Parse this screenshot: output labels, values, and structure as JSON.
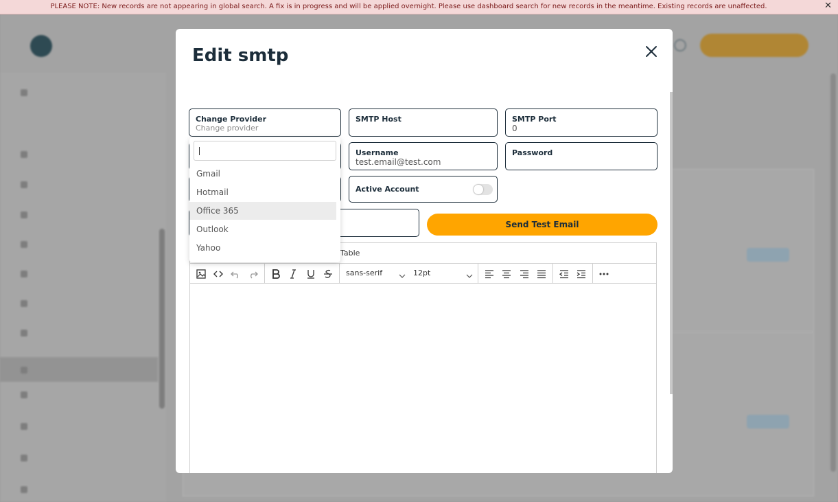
{
  "banner": {
    "text": "PLEASE NOTE: New records are not appearing in global search. A fix is in progress and will be applied overnight. Please use dashboard search for new records in the meantime. Existing records are unaffected.",
    "close": "✕"
  },
  "modal": {
    "title": "Edit smtp",
    "fields": {
      "change_provider": {
        "label": "Change Provider",
        "placeholder": "Change provider"
      },
      "smtp_host": {
        "label": "SMTP Host",
        "value": ""
      },
      "smtp_port": {
        "label": "SMTP Port",
        "value": "0"
      },
      "username": {
        "label": "Username",
        "value": "test.email@test.com"
      },
      "password": {
        "label": "Password",
        "value": ""
      },
      "active_account": {
        "label": "Active Account",
        "checked": false
      }
    },
    "send_test_label": "Send Test Email",
    "editor": {
      "menu": [
        "Table"
      ],
      "font_family": "sans-serif",
      "font_size": "12pt"
    }
  },
  "dropdown": {
    "search_value": "",
    "options": [
      "Gmail",
      "Hotmail",
      "Office 365",
      "Outlook",
      "Yahoo"
    ],
    "highlighted": "Office 365"
  },
  "colors": {
    "accent": "#ffa500",
    "text": "#1c2d3a",
    "banner_bg": "#f4d8d8",
    "banner_text": "#7a1a1a"
  }
}
